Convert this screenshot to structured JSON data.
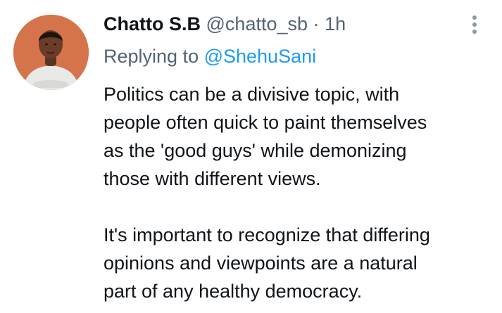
{
  "author": {
    "display_name": "Chatto S.B",
    "handle": "@chatto_sb",
    "separator": "·",
    "timestamp": "1h",
    "avatar_icon": "avatar-photo"
  },
  "reply": {
    "prefix": "Replying to",
    "mention": "@ShehuSani"
  },
  "tweet": {
    "lines": [
      "Politics can be a divisive topic, with",
      "people often quick to paint themselves",
      "as the 'good guys' while demonizing",
      "those with different views.",
      "It's important to recognize that differing",
      "opinions and viewpoints are a natural",
      "part of any healthy democracy."
    ]
  },
  "icons": {
    "more": "more-options-icon"
  },
  "colors": {
    "text": "#0f1419",
    "secondary": "#536471",
    "link": "#1d9bf0",
    "avatar_bg": "#d5744a"
  }
}
